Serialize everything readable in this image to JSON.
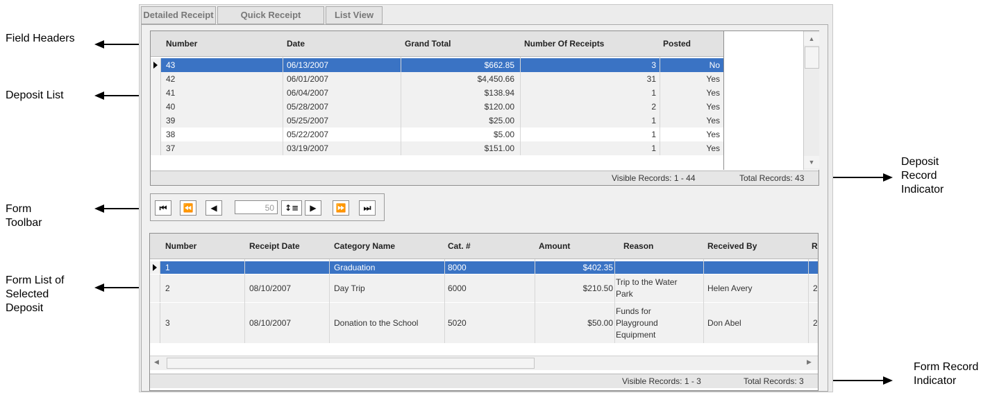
{
  "tabs": [
    "Detailed Receipt",
    "Quick Receipt",
    "List View"
  ],
  "deposit_grid": {
    "columns": [
      "Number",
      "Date",
      "Grand Total",
      "Number Of Receipts",
      "Posted"
    ],
    "rows": [
      [
        "43",
        "06/13/2007",
        "$662.85",
        "3",
        "No"
      ],
      [
        "42",
        "06/01/2007",
        "$4,450.66",
        "31",
        "Yes"
      ],
      [
        "41",
        "06/04/2007",
        "$138.94",
        "1",
        "Yes"
      ],
      [
        "40",
        "05/28/2007",
        "$120.00",
        "2",
        "Yes"
      ],
      [
        "39",
        "05/25/2007",
        "$25.00",
        "1",
        "Yes"
      ],
      [
        "38",
        "05/22/2007",
        "$5.00",
        "1",
        "Yes"
      ],
      [
        "37",
        "03/19/2007",
        "$151.00",
        "1",
        "Yes"
      ]
    ],
    "visible_records": "Visible Records: 1 - 44",
    "total_records": "Total Records: 43"
  },
  "toolbar": {
    "first": "⏮",
    "prev_page": "⏪",
    "prev": "◀",
    "page_size": "50",
    "set_size": "↕≡",
    "next": "▶",
    "next_page": "⏩",
    "last": "⏭"
  },
  "form_grid": {
    "columns": [
      "Number",
      "Receipt Date",
      "Category Name",
      "Cat. #",
      "Amount",
      "Reason",
      "Received By",
      "R"
    ],
    "rows": [
      [
        "1",
        "",
        "Graduation",
        "8000",
        "$402.35",
        "",
        "",
        ""
      ],
      [
        "2",
        "08/10/2007",
        "Day Trip",
        "6000",
        "$210.50",
        "Trip to the Water Park",
        "Helen Avery",
        "2"
      ],
      [
        "3",
        "08/10/2007",
        "Donation to the School",
        "5020",
        "$50.00",
        "Funds for Playground Equipment",
        "Don Abel",
        "2"
      ]
    ],
    "visible_records": "Visible Records: 1 - 3",
    "total_records": "Total Records: 3"
  },
  "annotations": {
    "field_headers": "Field Headers",
    "deposit_list": "Deposit List",
    "form_toolbar": "Form Toolbar",
    "form_list": "Form List of Selected Deposit",
    "deposit_record_indicator": "Deposit Record Indicator",
    "form_record_indicator": "Form Record Indicator"
  }
}
